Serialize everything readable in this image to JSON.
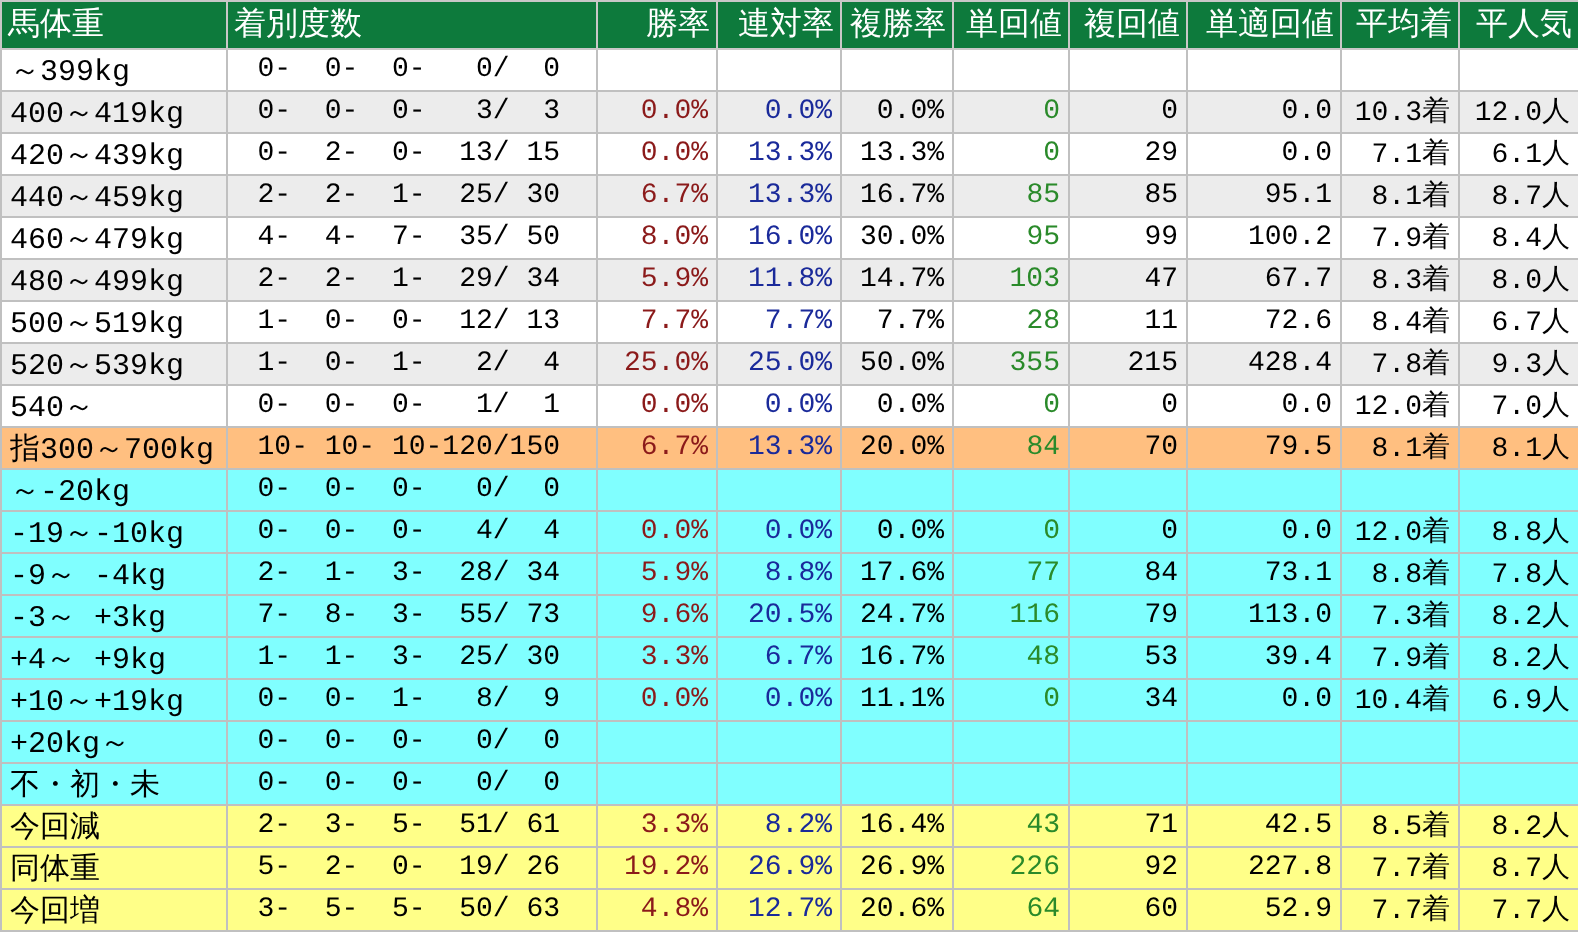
{
  "table": {
    "columns": [
      "馬体重",
      "着別度数",
      "勝率",
      "連対率",
      "複勝率",
      "単回値",
      "複回値",
      "単適回値",
      "平均着",
      "平人気"
    ],
    "rows": [
      {
        "kind": "weight",
        "shaded": false,
        "label": "～399kg",
        "record": "0-  0-  0-   0/  0"
      },
      {
        "kind": "weight",
        "shaded": true,
        "label": "400～419kg",
        "record": "0-  0-  0-   3/  3",
        "stats": [
          "0.0%",
          "0.0%",
          "0.0%",
          "0",
          "0",
          "0.0",
          "10.3着",
          "12.0人"
        ]
      },
      {
        "kind": "weight",
        "shaded": false,
        "label": "420～439kg",
        "record": "0-  2-  0-  13/ 15",
        "stats": [
          "0.0%",
          "13.3%",
          "13.3%",
          "0",
          "29",
          "0.0",
          "7.1着",
          "6.1人"
        ]
      },
      {
        "kind": "weight",
        "shaded": true,
        "label": "440～459kg",
        "record": "2-  2-  1-  25/ 30",
        "stats": [
          "6.7%",
          "13.3%",
          "16.7%",
          "85",
          "85",
          "95.1",
          "8.1着",
          "8.7人"
        ]
      },
      {
        "kind": "weight",
        "shaded": false,
        "label": "460～479kg",
        "record": "4-  4-  7-  35/ 50",
        "stats": [
          "8.0%",
          "16.0%",
          "30.0%",
          "95",
          "99",
          "100.2",
          "7.9着",
          "8.4人"
        ]
      },
      {
        "kind": "weight",
        "shaded": true,
        "label": "480～499kg",
        "record": "2-  2-  1-  29/ 34",
        "stats": [
          "5.9%",
          "11.8%",
          "14.7%",
          "103",
          "47",
          "67.7",
          "8.3着",
          "8.0人"
        ]
      },
      {
        "kind": "weight",
        "shaded": false,
        "label": "500～519kg",
        "record": "1-  0-  0-  12/ 13",
        "stats": [
          "7.7%",
          "7.7%",
          "7.7%",
          "28",
          "11",
          "72.6",
          "8.4着",
          "6.7人"
        ]
      },
      {
        "kind": "weight",
        "shaded": true,
        "label": "520～539kg",
        "record": "1-  0-  1-   2/  4",
        "stats": [
          "25.0%",
          "25.0%",
          "50.0%",
          "355",
          "215",
          "428.4",
          "7.8着",
          "9.3人"
        ]
      },
      {
        "kind": "weight",
        "shaded": false,
        "label": "540～",
        "record": "0-  0-  0-   1/  1",
        "stats": [
          "0.0%",
          "0.0%",
          "0.0%",
          "0",
          "0",
          "0.0",
          "12.0着",
          "7.0人"
        ]
      },
      {
        "kind": "total",
        "shaded": false,
        "label": "指300～700kg",
        "record": "10- 10- 10-120/150",
        "stats": [
          "6.7%",
          "13.3%",
          "20.0%",
          "84",
          "70",
          "79.5",
          "8.1着",
          "8.1人"
        ]
      },
      {
        "kind": "change",
        "shaded": false,
        "label": "～-20kg",
        "record": "0-  0-  0-   0/  0"
      },
      {
        "kind": "change",
        "shaded": false,
        "label": "-19～-10kg",
        "record": "0-  0-  0-   4/  4",
        "stats": [
          "0.0%",
          "0.0%",
          "0.0%",
          "0",
          "0",
          "0.0",
          "12.0着",
          "8.8人"
        ]
      },
      {
        "kind": "change",
        "shaded": false,
        "label": "-9～ -4kg",
        "record": "2-  1-  3-  28/ 34",
        "stats": [
          "5.9%",
          "8.8%",
          "17.6%",
          "77",
          "84",
          "73.1",
          "8.8着",
          "7.8人"
        ]
      },
      {
        "kind": "change",
        "shaded": false,
        "label": "-3～ +3kg",
        "record": "7-  8-  3-  55/ 73",
        "stats": [
          "9.6%",
          "20.5%",
          "24.7%",
          "116",
          "79",
          "113.0",
          "7.3着",
          "8.2人"
        ]
      },
      {
        "kind": "change",
        "shaded": false,
        "label": "+4～ +9kg",
        "record": "1-  1-  3-  25/ 30",
        "stats": [
          "3.3%",
          "6.7%",
          "16.7%",
          "48",
          "53",
          "39.4",
          "7.9着",
          "8.2人"
        ]
      },
      {
        "kind": "change",
        "shaded": false,
        "label": "+10～+19kg",
        "record": "0-  0-  1-   8/  9",
        "stats": [
          "0.0%",
          "0.0%",
          "11.1%",
          "0",
          "34",
          "0.0",
          "10.4着",
          "6.9人"
        ]
      },
      {
        "kind": "change",
        "shaded": false,
        "label": "+20kg～",
        "record": "0-  0-  0-   0/  0"
      },
      {
        "kind": "change",
        "shaded": false,
        "label": "不・初・未",
        "record": "0-  0-  0-   0/  0"
      },
      {
        "kind": "compare",
        "shaded": false,
        "label": "今回減",
        "record": "2-  3-  5-  51/ 61",
        "stats": [
          "3.3%",
          "8.2%",
          "16.4%",
          "43",
          "71",
          "42.5",
          "8.5着",
          "8.2人"
        ]
      },
      {
        "kind": "compare",
        "shaded": false,
        "label": "同体重",
        "record": "5-  2-  0-  19/ 26",
        "stats": [
          "19.2%",
          "26.9%",
          "26.9%",
          "226",
          "92",
          "227.8",
          "7.7着",
          "8.7人"
        ]
      },
      {
        "kind": "compare",
        "shaded": false,
        "label": "今回増",
        "record": "3-  5-  5-  50/ 63",
        "stats": [
          "4.8%",
          "12.7%",
          "20.6%",
          "64",
          "60",
          "52.9",
          "7.7着",
          "7.7人"
        ]
      }
    ]
  }
}
